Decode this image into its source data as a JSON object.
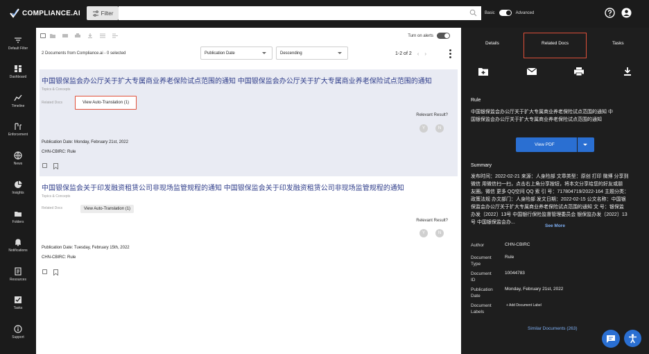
{
  "app": {
    "brand": "COMPLIANCE.AI"
  },
  "topbar": {
    "filter_label": "Filter",
    "search_placeholder": "",
    "mode_basic": "Basic",
    "mode_advanced": "Advanced"
  },
  "sidebar": {
    "items": [
      {
        "label": "Default Filter",
        "icon": "filter-icon"
      },
      {
        "label": "Dashboard",
        "icon": "dashboard-icon"
      },
      {
        "label": "Timeline",
        "icon": "timeline-icon"
      },
      {
        "label": "Enforcement",
        "icon": "enforcement-icon"
      },
      {
        "label": "News",
        "icon": "globe-icon"
      },
      {
        "label": "Insights",
        "icon": "insights-icon"
      },
      {
        "label": "Folders",
        "icon": "folder-icon"
      },
      {
        "label": "Notifications",
        "icon": "bell-icon"
      },
      {
        "label": "Resources",
        "icon": "book-icon"
      },
      {
        "label": "Tasks",
        "icon": "checkbox-icon"
      },
      {
        "label": "Support",
        "icon": "info-icon"
      }
    ]
  },
  "list": {
    "alerts_label": "Turn on alerts",
    "count_text": "2 Documents from Compliance.ai - 0 selected",
    "sort_field": "Publication Date",
    "sort_order": "Descending",
    "pagination": "1-2 of 2",
    "documents": [
      {
        "title": "中国银保监会办公厅关于扩大专属商业养老保险试点范围的通知 中国银保监会办公厅关于扩大专属商业养老保险试点范围的通知",
        "topics_label": "Topics & Concepts",
        "related_label": "Related Docs",
        "auto_translation": "View Auto-Translation (1)",
        "relevant_label": "Relevant Result?",
        "yes": "Y",
        "no": "N",
        "publication_date": "Publication Date: Monday, February 21st, 2022",
        "agency": "CHN-CBIRC:  Rule"
      },
      {
        "title": "中国银保监会关于印发融资租赁公司非现场监管规程的通知 中国银保监会关于印发融资租赁公司非现场监管规程的通知",
        "topics_label": "Topics & Concepts",
        "related_label": "Related Docs",
        "auto_translation": "View Auto-Translation (1)",
        "relevant_label": "Relevant Result?",
        "yes": "Y",
        "no": "N",
        "publication_date": "Publication Date: Tuesday, February 15th, 2022",
        "agency": "CHN-CBIRC:  Rule"
      }
    ]
  },
  "panel": {
    "tabs": {
      "details": "Details",
      "related": "Related Docs",
      "tasks": "Tasks"
    },
    "doc_type": "Rule",
    "title_line1": "中国银保监会办公厅关于扩大专属商业养老保险试点范围的通知 中",
    "title_line2": "国银保监会办公厅关于扩大专属商业养老保险试点范围的通知",
    "view_pdf": "View PDF",
    "summary_label": "Summary",
    "summary_lines": [
      "发布时间：2022-02-21 来源：人身险部 文章类型：原创 打印 微博 分享到",
      "微信 用微信扫一扫，点击右上角分享按钮，将本文分享给您的好友或朋",
      "友圈。微信 更多 QQ空间 QQ 索 引 号：717804719/2022-164 主题分类：",
      "政策法规 办文部门：人身险部 发文日期：2022-02-15 公文名称：中国银",
      "保监会办公厅关于扩大专属商业养老保险试点范围的通知 文 号：银保监",
      "办发〔2022〕13号 中国银行保险监督管理委员会 银保监办发〔2022〕13",
      "号 中国银保监会办..."
    ],
    "see_more": "See More",
    "details": {
      "author_k": "Author",
      "author_v": "CHN-CBIRC",
      "type_k1": "Document",
      "type_k2": "Type",
      "type_v": "Rule",
      "id_k1": "Document",
      "id_k2": "ID",
      "id_v": "10044783",
      "pub_k1": "Publication",
      "pub_k2": "Date",
      "pub_v": "Monday, February 21st, 2022",
      "labels_k1": "Document",
      "labels_k2": "Labels",
      "labels_v": "+ Add Document Label"
    },
    "similar": "Similar Documents (263)"
  },
  "colors": {
    "accent": "#2a6fd2",
    "highlight_border": "#e0503a",
    "title_link": "#2f3d8a",
    "dark_bg": "#1b1b1b"
  }
}
